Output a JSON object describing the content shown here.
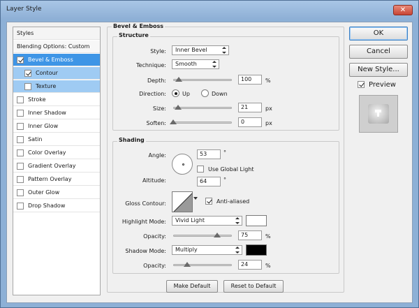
{
  "window": {
    "title": "Layer Style",
    "close_glyph": "✕"
  },
  "sidebar": {
    "header": "Styles",
    "blending": "Blending Options: Custom",
    "items": [
      {
        "label": "Bevel & Emboss",
        "checked": true
      },
      {
        "label": "Contour",
        "checked": true
      },
      {
        "label": "Texture",
        "checked": false
      },
      {
        "label": "Stroke",
        "checked": false
      },
      {
        "label": "Inner Shadow",
        "checked": false
      },
      {
        "label": "Inner Glow",
        "checked": false
      },
      {
        "label": "Satin",
        "checked": false
      },
      {
        "label": "Color Overlay",
        "checked": false
      },
      {
        "label": "Gradient Overlay",
        "checked": false
      },
      {
        "label": "Pattern Overlay",
        "checked": false
      },
      {
        "label": "Outer Glow",
        "checked": false
      },
      {
        "label": "Drop Shadow",
        "checked": false
      }
    ]
  },
  "panel": {
    "section_title": "Bevel & Emboss",
    "structure": {
      "title": "Structure",
      "style_label": "Style:",
      "style_value": "Inner Bevel",
      "technique_label": "Technique:",
      "technique_value": "Smooth",
      "depth_label": "Depth:",
      "depth_value": "100",
      "depth_unit": "%",
      "direction_label": "Direction:",
      "dir_up": "Up",
      "dir_down": "Down",
      "size_label": "Size:",
      "size_value": "21",
      "size_unit": "px",
      "soften_label": "Soften:",
      "soften_value": "0",
      "soften_unit": "px"
    },
    "shading": {
      "title": "Shading",
      "angle_label": "Angle:",
      "angle_value": "53",
      "deg": "°",
      "global_light_label": "Use Global Light",
      "altitude_label": "Altitude:",
      "altitude_value": "64",
      "gloss_label": "Gloss Contour:",
      "anti_aliased_label": "Anti-aliased",
      "highlight_mode_label": "Highlight Mode:",
      "highlight_mode_value": "Vivid Light",
      "highlight_opacity_label": "Opacity:",
      "highlight_opacity_value": "75",
      "pct": "%",
      "shadow_mode_label": "Shadow Mode:",
      "shadow_mode_value": "Multiply",
      "shadow_opacity_label": "Opacity:",
      "shadow_opacity_value": "24"
    },
    "make_default": "Make Default",
    "reset_default": "Reset to Default"
  },
  "actions": {
    "ok": "OK",
    "cancel": "Cancel",
    "new_style": "New Style...",
    "preview": "Preview"
  },
  "colors": {
    "highlight": "#ffffff",
    "shadow": "#000000",
    "accent": "#3e95e6"
  },
  "values": {
    "depth_fraction": 0.1,
    "size_fraction": 0.08,
    "soften_fraction": 0.0,
    "highlight_opacity_fraction": 0.75,
    "shadow_opacity_fraction": 0.24
  }
}
